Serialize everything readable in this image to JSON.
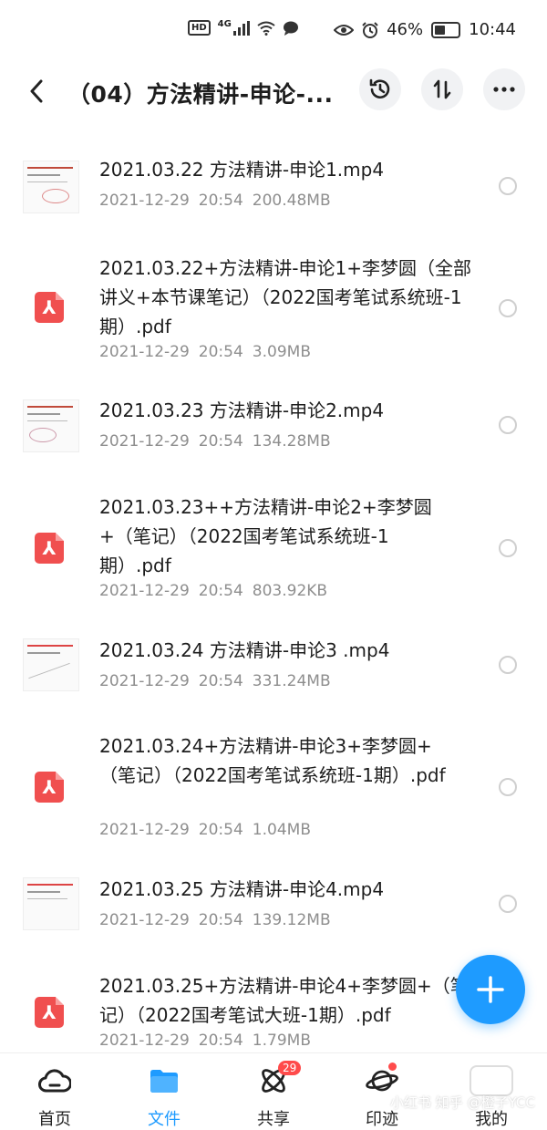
{
  "status_bar": {
    "hd": "HD",
    "network": "4G",
    "battery": "46%",
    "time": "10:44"
  },
  "header": {
    "title": "（04）方法精讲-申论-..."
  },
  "files": [
    {
      "name": "2021.03.22 方法精讲-申论1.mp4",
      "date": "2021-12-29",
      "time": "20:54",
      "size": "200.48MB",
      "type": "video"
    },
    {
      "name": "2021.03.22+方法精讲-申论1+李梦圆（全部讲义+本节课笔记）（2022国考笔试系统班-1期）.pdf",
      "date": "2021-12-29",
      "time": "20:54",
      "size": "3.09MB",
      "type": "pdf"
    },
    {
      "name": "2021.03.23 方法精讲-申论2.mp4",
      "date": "2021-12-29",
      "time": "20:54",
      "size": "134.28MB",
      "type": "video"
    },
    {
      "name": "2021.03.23++方法精讲-申论2+李梦圆+（笔记）（2022国考笔试系统班-1期）.pdf",
      "date": "2021-12-29",
      "time": "20:54",
      "size": "803.92KB",
      "type": "pdf"
    },
    {
      "name": "2021.03.24 方法精讲-申论3 .mp4",
      "date": "2021-12-29",
      "time": "20:54",
      "size": "331.24MB",
      "type": "video"
    },
    {
      "name": "2021.03.24+方法精讲-申论3+李梦圆+（笔记）（2022国考笔试系统班-1期）.pdf",
      "date": "2021-12-29",
      "time": "20:54",
      "size": "1.04MB",
      "type": "pdf"
    },
    {
      "name": "2021.03.25 方法精讲-申论4.mp4",
      "date": "2021-12-29",
      "time": "20:54",
      "size": "139.12MB",
      "type": "video"
    },
    {
      "name": "2021.03.25+方法精讲-申论4+李梦圆+（笔记）（2022国考笔试大班-1期）.pdf",
      "date": "2021-12-29",
      "time": "20:54",
      "size": "1.79MB",
      "type": "pdf"
    }
  ],
  "tabs": [
    {
      "label": "首页",
      "icon": "cloud-icon"
    },
    {
      "label": "文件",
      "icon": "folder-icon",
      "active": true
    },
    {
      "label": "共享",
      "icon": "atom-icon",
      "badge": "29"
    },
    {
      "label": "印迹",
      "icon": "planet-icon"
    },
    {
      "label": "我的",
      "icon": "profile-icon"
    }
  ],
  "watermark": "小红书 知乎 @橙子YCC",
  "colors": {
    "accent": "#1e9bff",
    "pdf": "#f04f4f",
    "badge": "#ff4b4b"
  }
}
